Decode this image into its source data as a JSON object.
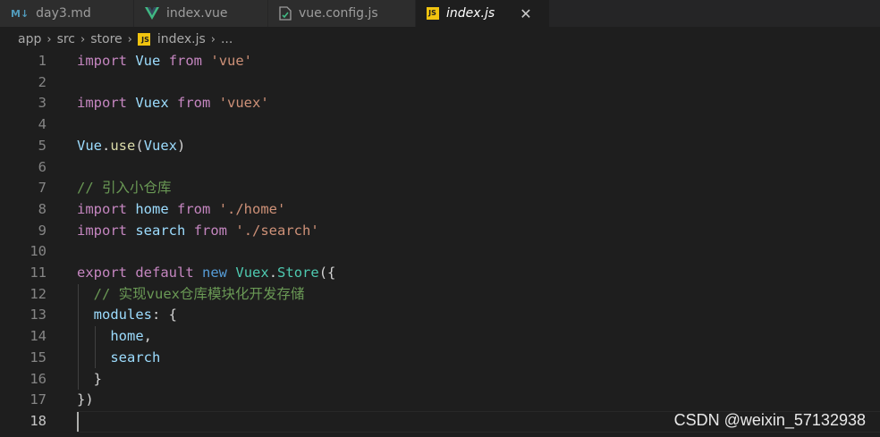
{
  "tabs": [
    {
      "label": "day3.md",
      "icon": "markdown-icon",
      "icon_text": "M↓"
    },
    {
      "label": "index.vue",
      "icon": "vue-icon"
    },
    {
      "label": "vue.config.js",
      "icon": "config-file-icon"
    },
    {
      "label": "index.js",
      "icon": "js-icon",
      "icon_text": "JS",
      "active": true,
      "close": "✕"
    }
  ],
  "breadcrumb": {
    "items": [
      "app",
      "src",
      "store"
    ],
    "file_icon_text": "JS",
    "file": "index.js",
    "tail": "...",
    "separator": "›"
  },
  "editor": {
    "lines": [
      {
        "n": "1",
        "tokens": [
          {
            "t": "import",
            "c": "#c586c0"
          },
          {
            "t": " "
          },
          {
            "t": "Vue",
            "c": "#9cdcfe"
          },
          {
            "t": " "
          },
          {
            "t": "from",
            "c": "#c586c0"
          },
          {
            "t": " "
          },
          {
            "t": "'vue'",
            "c": "#ce9178"
          }
        ]
      },
      {
        "n": "2",
        "tokens": []
      },
      {
        "n": "3",
        "tokens": [
          {
            "t": "import",
            "c": "#c586c0"
          },
          {
            "t": " "
          },
          {
            "t": "Vuex",
            "c": "#9cdcfe"
          },
          {
            "t": " "
          },
          {
            "t": "from",
            "c": "#c586c0"
          },
          {
            "t": " "
          },
          {
            "t": "'vuex'",
            "c": "#ce9178"
          }
        ]
      },
      {
        "n": "4",
        "tokens": []
      },
      {
        "n": "5",
        "tokens": [
          {
            "t": "Vue",
            "c": "#9cdcfe"
          },
          {
            "t": ".",
            "c": "#d4d4d4"
          },
          {
            "t": "use",
            "c": "#dcdcaa"
          },
          {
            "t": "(",
            "c": "#d4d4d4"
          },
          {
            "t": "Vuex",
            "c": "#9cdcfe"
          },
          {
            "t": ")",
            "c": "#d4d4d4"
          }
        ]
      },
      {
        "n": "6",
        "tokens": []
      },
      {
        "n": "7",
        "tokens": [
          {
            "t": "// 引入小仓库",
            "c": "#6a9955"
          }
        ]
      },
      {
        "n": "8",
        "tokens": [
          {
            "t": "import",
            "c": "#c586c0"
          },
          {
            "t": " "
          },
          {
            "t": "home",
            "c": "#9cdcfe"
          },
          {
            "t": " "
          },
          {
            "t": "from",
            "c": "#c586c0"
          },
          {
            "t": " "
          },
          {
            "t": "'./home'",
            "c": "#ce9178"
          }
        ]
      },
      {
        "n": "9",
        "tokens": [
          {
            "t": "import",
            "c": "#c586c0"
          },
          {
            "t": " "
          },
          {
            "t": "search",
            "c": "#9cdcfe"
          },
          {
            "t": " "
          },
          {
            "t": "from",
            "c": "#c586c0"
          },
          {
            "t": " "
          },
          {
            "t": "'./search'",
            "c": "#ce9178"
          }
        ]
      },
      {
        "n": "10",
        "tokens": []
      },
      {
        "n": "11",
        "tokens": [
          {
            "t": "export",
            "c": "#c586c0"
          },
          {
            "t": " "
          },
          {
            "t": "default",
            "c": "#c586c0"
          },
          {
            "t": " "
          },
          {
            "t": "new",
            "c": "#569cd6"
          },
          {
            "t": " "
          },
          {
            "t": "Vuex",
            "c": "#4ec9b0"
          },
          {
            "t": ".",
            "c": "#d4d4d4"
          },
          {
            "t": "Store",
            "c": "#4ec9b0"
          },
          {
            "t": "({",
            "c": "#d4d4d4"
          }
        ]
      },
      {
        "n": "12",
        "tokens": [
          {
            "t": "  "
          },
          {
            "t": "// 实现vuex仓库模块化开发存储",
            "c": "#6a9955"
          }
        ]
      },
      {
        "n": "13",
        "tokens": [
          {
            "t": "  "
          },
          {
            "t": "modules",
            "c": "#9cdcfe"
          },
          {
            "t": ": {",
            "c": "#d4d4d4"
          }
        ]
      },
      {
        "n": "14",
        "tokens": [
          {
            "t": "    "
          },
          {
            "t": "home",
            "c": "#9cdcfe"
          },
          {
            "t": ",",
            "c": "#d4d4d4"
          }
        ]
      },
      {
        "n": "15",
        "tokens": [
          {
            "t": "    "
          },
          {
            "t": "search",
            "c": "#9cdcfe"
          }
        ]
      },
      {
        "n": "16",
        "tokens": [
          {
            "t": "  "
          },
          {
            "t": "}",
            "c": "#d4d4d4"
          }
        ]
      },
      {
        "n": "17",
        "tokens": [
          {
            "t": "})",
            "c": "#d4d4d4"
          }
        ]
      },
      {
        "n": "18",
        "tokens": []
      }
    ]
  },
  "watermark": "CSDN @weixin_57132938"
}
